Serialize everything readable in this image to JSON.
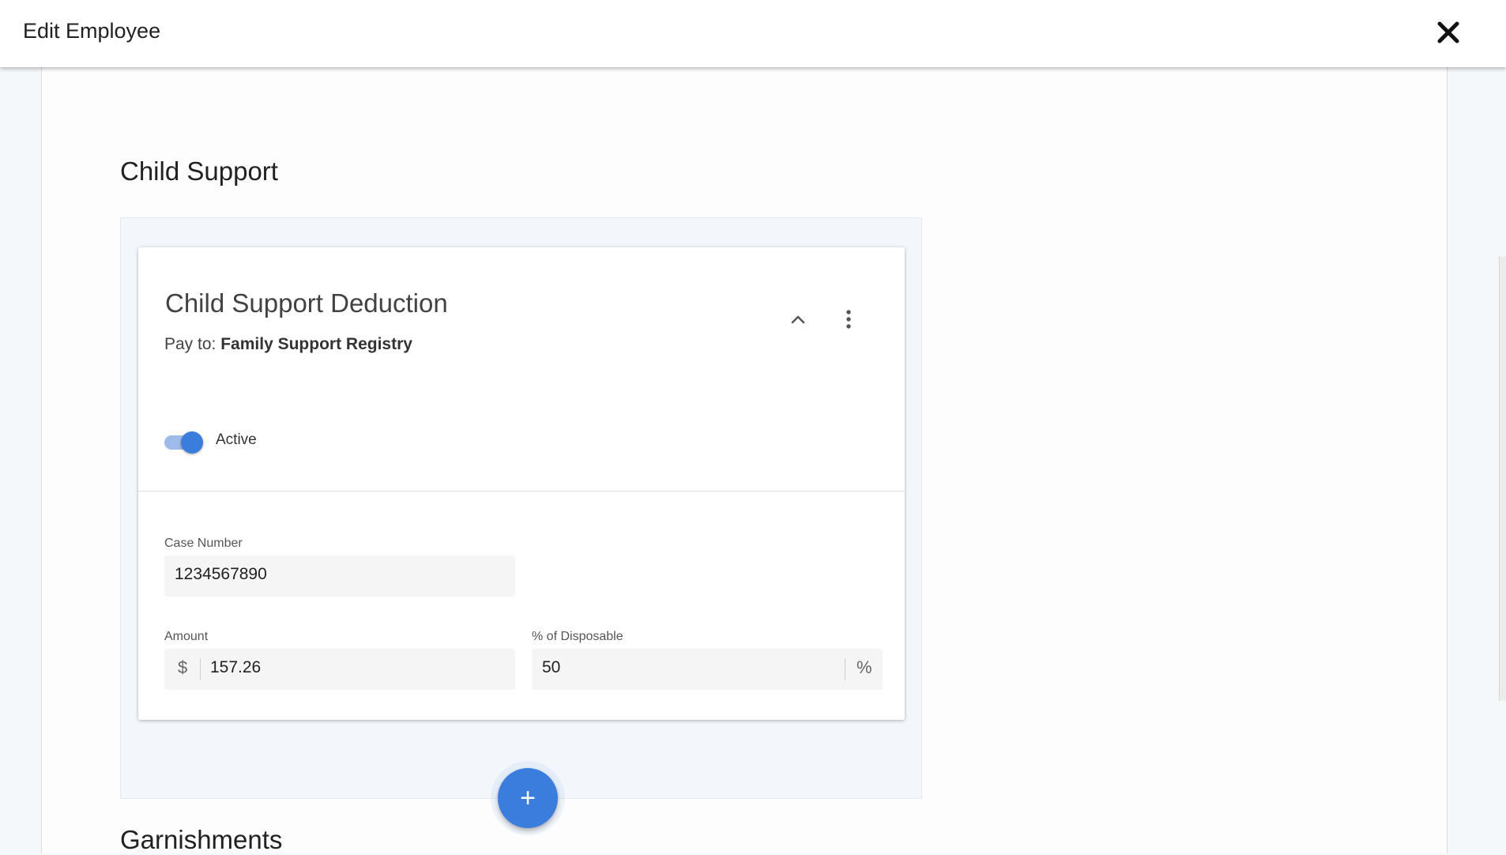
{
  "dialog": {
    "title": "Edit Employee"
  },
  "child_support_section": {
    "title": "Child Support",
    "card": {
      "title": "Child Support Deduction",
      "pay_to_label": "Pay to:",
      "pay_to_value": "Family Support Registry",
      "active_toggle": {
        "label": "Active",
        "checked": true
      },
      "case_number": {
        "label": "Case Number",
        "value": "1234567890"
      },
      "amount": {
        "label": "Amount",
        "prefix": "$",
        "value": "157.26"
      },
      "percent_disposable": {
        "label": "% of Disposable",
        "value": "50",
        "suffix": "%"
      }
    },
    "add_button_label": "+"
  },
  "garnishments_section": {
    "title": "Garnishments"
  },
  "colors": {
    "accent": "#3b7ddd",
    "panel_background": "#f3f7fc"
  },
  "icons": [
    "close-icon",
    "chevron-up-icon",
    "more-vert-icon",
    "plus-icon"
  ]
}
